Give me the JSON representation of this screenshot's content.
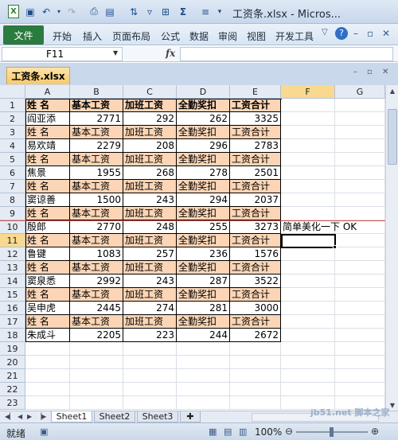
{
  "window": {
    "title": "工资条.xlsx - Micros..."
  },
  "quick_access": [
    "save-icon",
    "undo-icon",
    "redo-icon",
    "print-preview-icon",
    "format-painter-icon",
    "sort-icon",
    "border-icon",
    "sum-icon",
    "more-icon"
  ],
  "ribbon": {
    "file_tab": "文件",
    "tabs": [
      "开始",
      "插入",
      "页面布局",
      "公式",
      "数据",
      "审阅",
      "视图",
      "开发工具"
    ]
  },
  "formula_bar": {
    "name_box": "F11",
    "fx": "fx",
    "value": ""
  },
  "workbook_tab": "工资条.xlsx",
  "columns": [
    "A",
    "B",
    "C",
    "D",
    "E",
    "F",
    "G"
  ],
  "rows": [
    [
      "姓  名",
      "基本工资",
      "加班工资",
      "全勤奖扣",
      "工资合计"
    ],
    [
      "阎亚添",
      "2771",
      "292",
      "262",
      "3325"
    ],
    [
      "姓  名",
      "基本工资",
      "加班工资",
      "全勤奖扣",
      "工资合计"
    ],
    [
      "易欢靖",
      "2279",
      "208",
      "296",
      "2783"
    ],
    [
      "姓  名",
      "基本工资",
      "加班工资",
      "全勤奖扣",
      "工资合计"
    ],
    [
      "焦景",
      "1955",
      "268",
      "278",
      "2501"
    ],
    [
      "姓  名",
      "基本工资",
      "加班工资",
      "全勤奖扣",
      "工资合计"
    ],
    [
      "窦谅善",
      "1500",
      "243",
      "294",
      "2037"
    ],
    [
      "姓  名",
      "基本工资",
      "加班工资",
      "全勤奖扣",
      "工资合计"
    ],
    [
      "殷郎",
      "2770",
      "248",
      "255",
      "3273"
    ],
    [
      "姓  名",
      "基本工资",
      "加班工资",
      "全勤奖扣",
      "工资合计"
    ],
    [
      "鲁键",
      "1083",
      "257",
      "236",
      "1576"
    ],
    [
      "姓  名",
      "基本工资",
      "加班工资",
      "全勤奖扣",
      "工资合计"
    ],
    [
      "窦泉悉",
      "2992",
      "243",
      "287",
      "3522"
    ],
    [
      "姓  名",
      "基本工资",
      "加班工资",
      "全勤奖扣",
      "工资合计"
    ],
    [
      "吴申虎",
      "2445",
      "274",
      "281",
      "3000"
    ],
    [
      "姓  名",
      "基本工资",
      "加班工资",
      "全勤奖扣",
      "工资合计"
    ],
    [
      "朱成斗",
      "2205",
      "223",
      "244",
      "2672"
    ]
  ],
  "note_cell": {
    "ref": "F10",
    "text": "简单美化一下 OK"
  },
  "row_numbers": [
    "1",
    "2",
    "3",
    "4",
    "5",
    "6",
    "7",
    "8",
    "9",
    "10",
    "11",
    "12",
    "13",
    "14",
    "15",
    "16",
    "17",
    "18",
    "19",
    "20",
    "21",
    "22",
    "23"
  ],
  "sheets": [
    "Sheet1",
    "Sheet2",
    "Sheet3"
  ],
  "status": {
    "text": "就绪",
    "zoom": "100%"
  },
  "watermark": "jb51.net 脚本之家"
}
